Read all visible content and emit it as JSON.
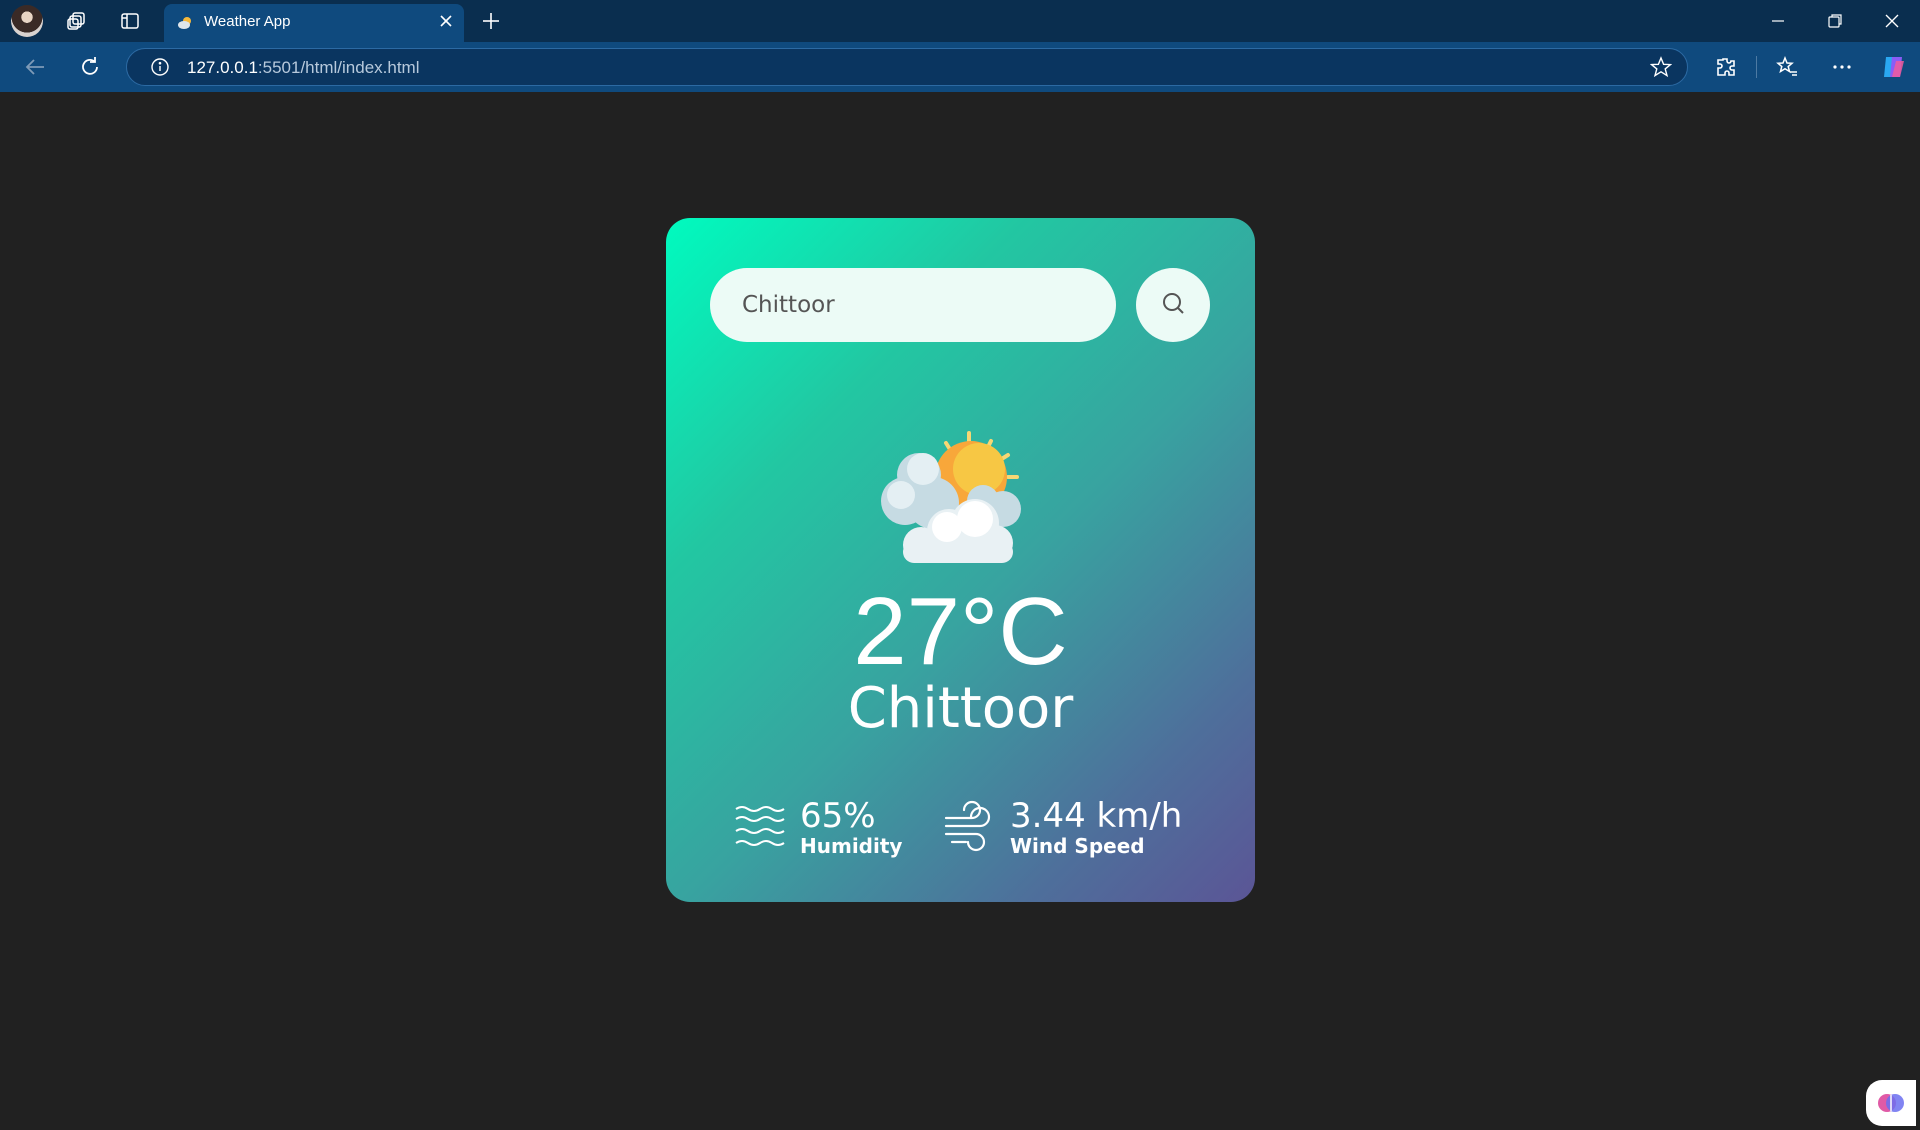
{
  "browser": {
    "tab": {
      "title": "Weather App"
    },
    "url": {
      "host": "127.0.0.1",
      "rest": ":5501/html/index.html"
    }
  },
  "weather": {
    "search": {
      "value": "Chittoor"
    },
    "temperature": "27°C",
    "city": "Chittoor",
    "humidity": {
      "value": "65%",
      "label": "Humidity"
    },
    "wind": {
      "value": "3.44 km/h",
      "label": "Wind Speed"
    },
    "condition_icon": "partly-cloudy-icon"
  }
}
